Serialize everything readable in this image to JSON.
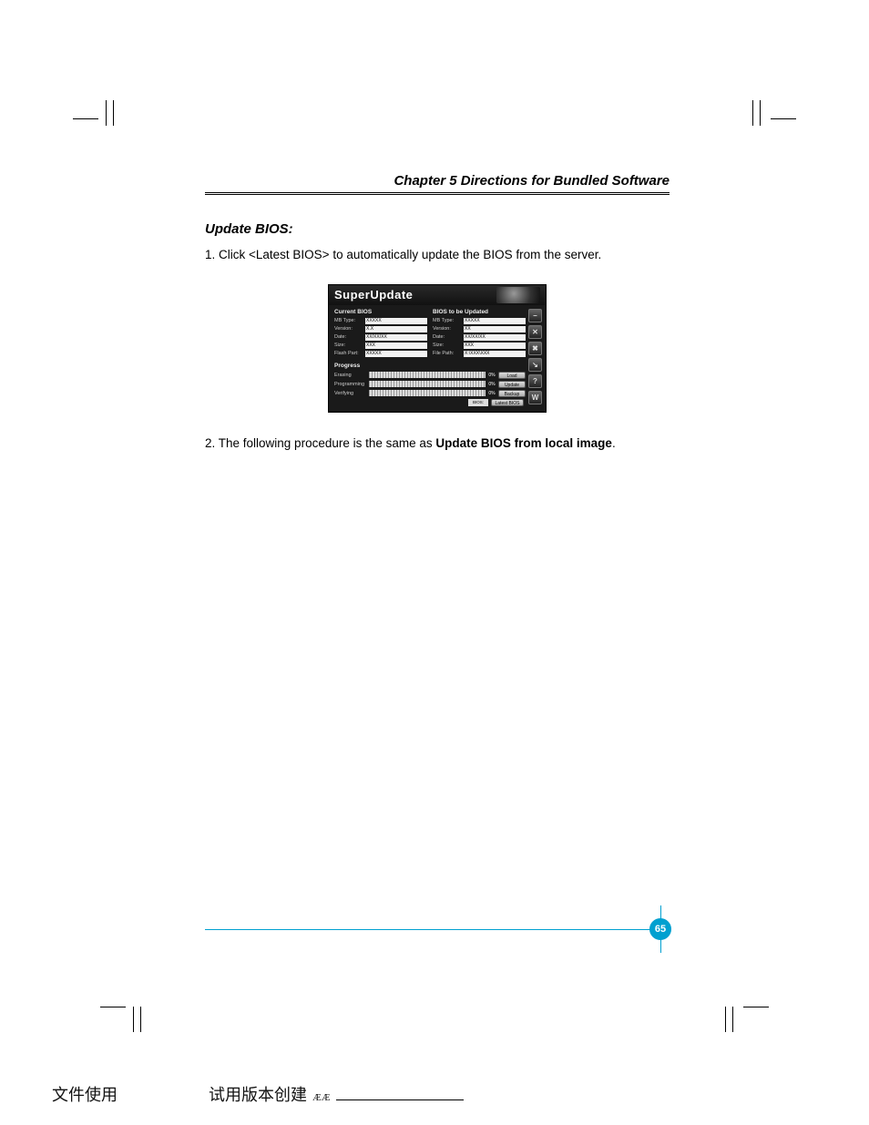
{
  "header": {
    "chapter_title": "Chapter 5  Directions for Bundled Software"
  },
  "section": {
    "heading": "Update BIOS:",
    "step1": "1. Click <Latest BIOS> to automatically update the BIOS from the server.",
    "step2_pre": "2. The following procedure is the same as ",
    "step2_bold": "Update BIOS from local image",
    "step2_post": "."
  },
  "screenshot": {
    "title": "SuperUpdate",
    "left_group": "Current BIOS",
    "right_group": "BIOS to be Updated",
    "fields_left": {
      "mb_type_label": "MB Type:",
      "mb_type_val": "XXXXX",
      "version_label": "Version:",
      "version_val": "X.X",
      "date_label": "Date:",
      "date_val": "XX/XX/XX",
      "size_label": "Size:",
      "size_val": "XXX",
      "flash_label": "Flash Part:",
      "flash_val": "XXXXX"
    },
    "fields_right": {
      "mb_type_label": "MB Type:",
      "mb_type_val": "XXXXX",
      "version_label": "Version:",
      "version_val": "XX",
      "date_label": "Date:",
      "date_val": "XX/XX/XX",
      "size_label": "Size:",
      "size_val": "XXX",
      "file_label": "File Path:",
      "file_val": "X:\\XXX\\XXX"
    },
    "progress_label": "Progress",
    "rows": {
      "erasing": "Erasing",
      "programming": "Programming",
      "verifying": "Verifying"
    },
    "pct": "0%",
    "buttons": {
      "load": "Load",
      "update": "Update",
      "backup": "Backup",
      "latest": "Latest BIOS",
      "bios_tag": "BIOS:"
    },
    "side_icons": [
      "minimize",
      "close",
      "tools",
      "link",
      "help",
      "w"
    ]
  },
  "footer": {
    "page_number": "65"
  },
  "watermark": {
    "left": "文件使用",
    "right": "试用版本创建",
    "glyph": "ÆÆ"
  }
}
